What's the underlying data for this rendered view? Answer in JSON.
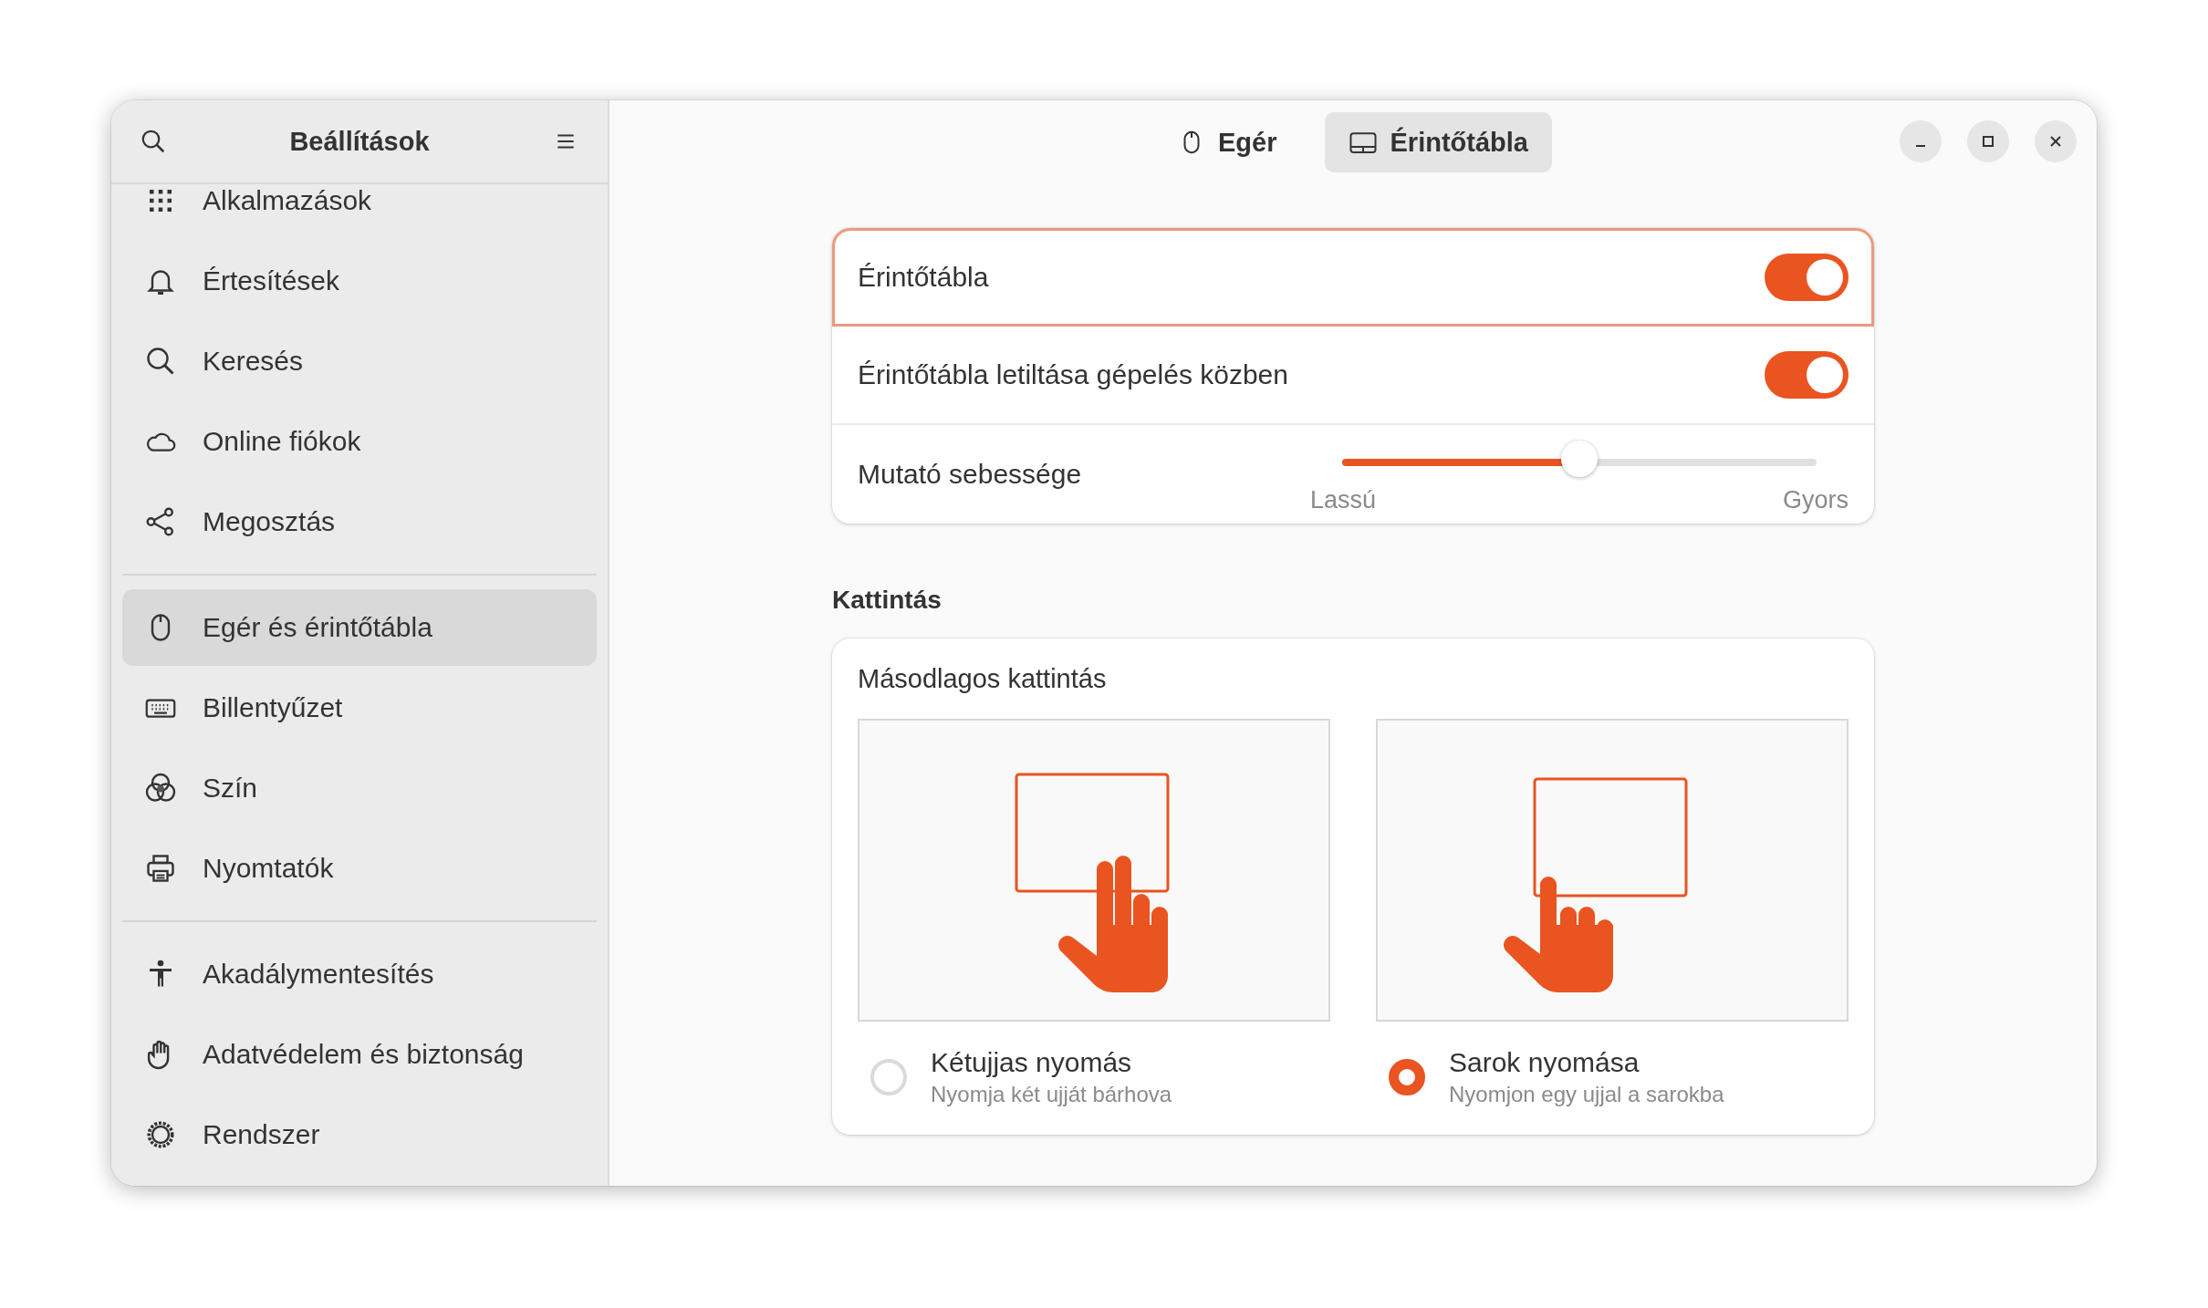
{
  "window": {
    "title": "Beállítások"
  },
  "sidebar": {
    "groups": [
      {
        "items": [
          {
            "label": "Alkalmazások",
            "selected": false
          },
          {
            "label": "Értesítések",
            "selected": false
          },
          {
            "label": "Keresés",
            "selected": false
          },
          {
            "label": "Online fiókok",
            "selected": false
          },
          {
            "label": "Megosztás",
            "selected": false
          }
        ]
      },
      {
        "items": [
          {
            "label": "Egér és érintőtábla",
            "selected": true
          },
          {
            "label": "Billentyűzet",
            "selected": false
          },
          {
            "label": "Szín",
            "selected": false
          },
          {
            "label": "Nyomtatók",
            "selected": false
          }
        ]
      },
      {
        "items": [
          {
            "label": "Akadálymentesítés",
            "selected": false
          },
          {
            "label": "Adatvédelem és biztonság",
            "selected": false
          },
          {
            "label": "Rendszer",
            "selected": false
          }
        ]
      }
    ]
  },
  "view_switcher": [
    {
      "label": "Egér",
      "selected": false
    },
    {
      "label": "Érintőtábla",
      "selected": true
    }
  ],
  "settings": [
    {
      "kind": "switch",
      "label": "Érintőtábla",
      "on": true,
      "focused": true
    },
    {
      "kind": "switch",
      "label": "Érintőtábla letiltása gépelés közben",
      "on": true,
      "focused": false
    },
    {
      "kind": "slider",
      "label": "Mutató sebessége",
      "level": 0.5,
      "marks": [
        "Lassú",
        "Gyors"
      ]
    }
  ],
  "click_section": {
    "title": "Kattintás",
    "card_title": "Másodlagos kattintás",
    "options": [
      {
        "label": "Kétujjas nyomás",
        "description": "Nyomja két ujját bárhova",
        "selected": false
      },
      {
        "label": "Sarok nyomása",
        "description": "Nyomjon egy ujjal a sarokba",
        "selected": true
      }
    ]
  }
}
